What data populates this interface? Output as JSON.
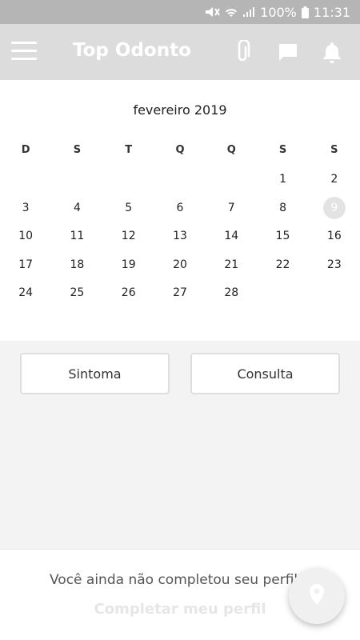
{
  "status_bar": {
    "battery": "100%",
    "time": "11:31"
  },
  "app_bar": {
    "title": "Top Odonto",
    "icons": [
      "menu-icon",
      "attachment-icon",
      "chat-icon",
      "bell-icon"
    ]
  },
  "calendar": {
    "month_label": "fevereiro 2019",
    "weekdays": [
      "D",
      "S",
      "T",
      "Q",
      "Q",
      "S",
      "S"
    ],
    "weeks": [
      [
        "",
        "",
        "",
        "",
        "",
        "1",
        "2"
      ],
      [
        "3",
        "4",
        "5",
        "6",
        "7",
        "8",
        "9"
      ],
      [
        "10",
        "11",
        "12",
        "13",
        "14",
        "15",
        "16"
      ],
      [
        "17",
        "18",
        "19",
        "20",
        "21",
        "22",
        "23"
      ],
      [
        "24",
        "25",
        "26",
        "27",
        "28",
        "",
        ""
      ]
    ],
    "today": "9"
  },
  "actions": {
    "symptom_label": "Sintoma",
    "appointment_label": "Consulta"
  },
  "footer": {
    "message": "Você ainda não completou seu perfil",
    "link_label": "Completar meu perfil"
  },
  "fab": {
    "icon": "location-pin-icon"
  },
  "colors": {
    "app_bar": "#dcdcdc",
    "status_bar": "#b5b5b5",
    "today_highlight": "#e3e3e3"
  }
}
